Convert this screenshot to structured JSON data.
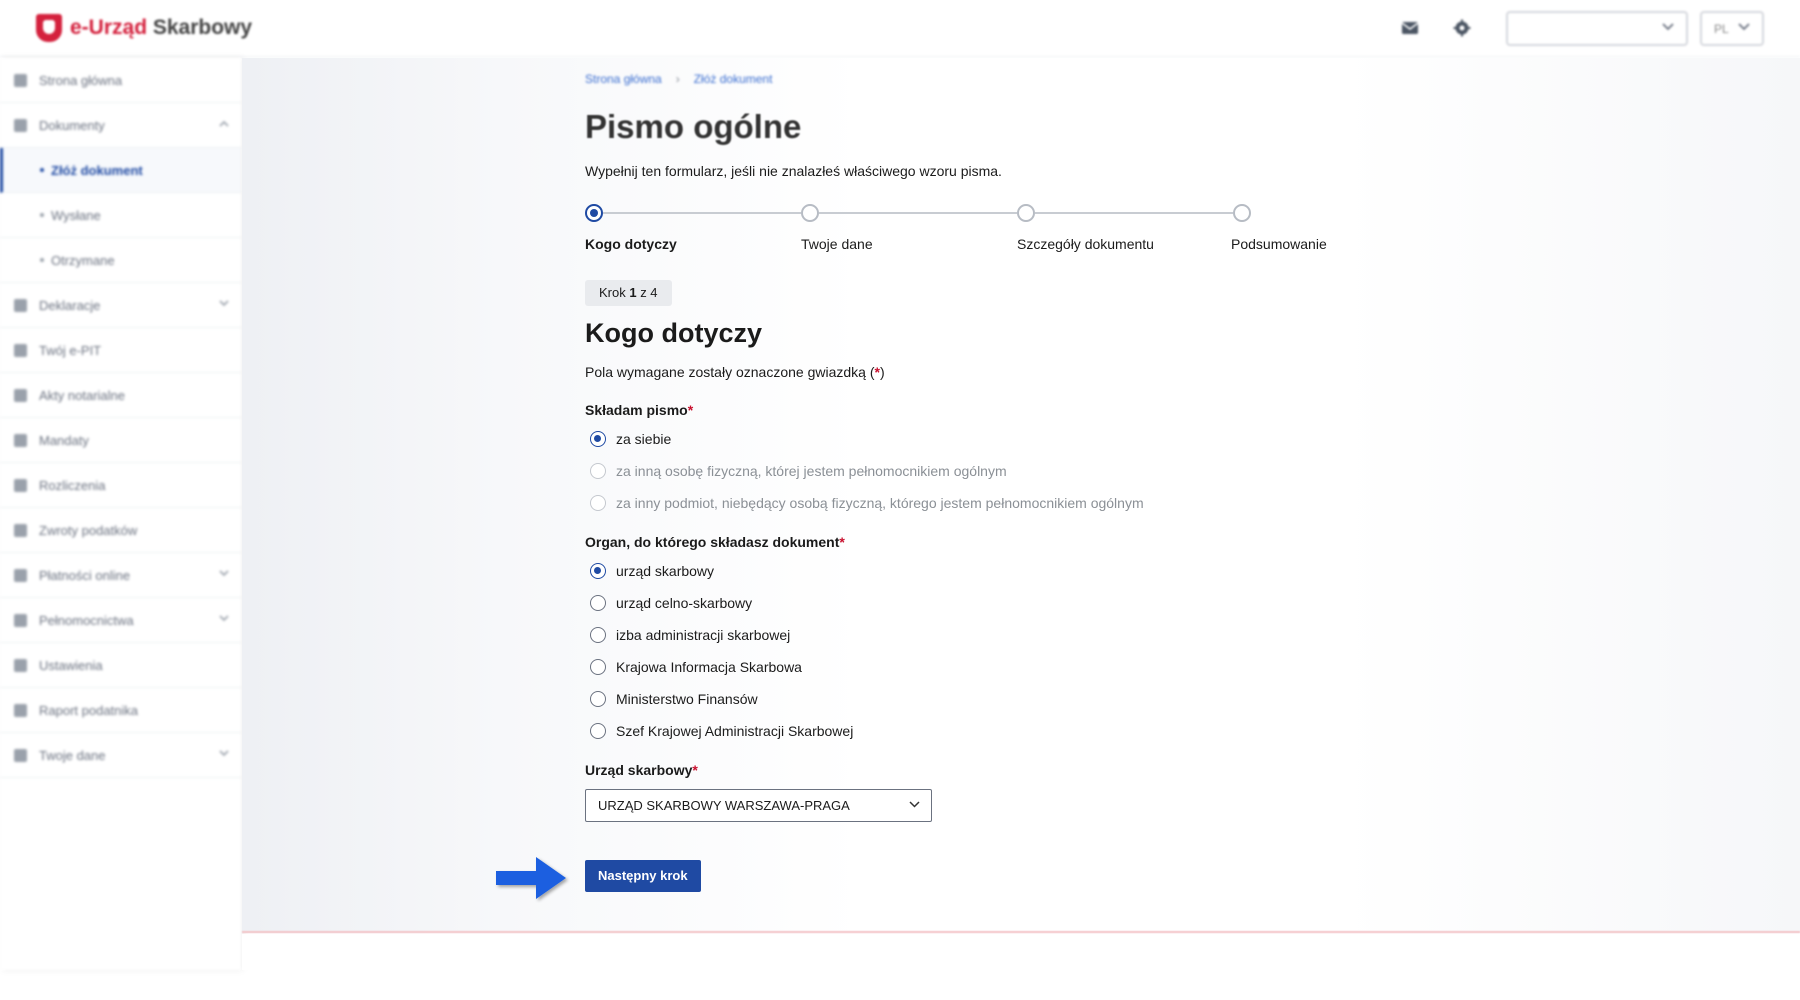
{
  "header": {
    "brand_accent": "e-Urząd",
    "brand_rest": " Skarbowy",
    "lang": "PL",
    "icons": [
      "mail-icon",
      "gear-icon"
    ]
  },
  "sidebar": {
    "items": [
      {
        "label": "Strona główna",
        "icon": "home-icon"
      },
      {
        "label": "Dokumenty",
        "icon": "document-icon",
        "expanded": true
      },
      {
        "label": "Złóż dokument",
        "sub": true,
        "active": true
      },
      {
        "label": "Wysłane",
        "sub": true
      },
      {
        "label": "Otrzymane",
        "sub": true
      },
      {
        "label": "Deklaracje",
        "icon": "document-icon",
        "collapsible": true
      },
      {
        "label": "Twój e-PIT",
        "icon": "document-icon"
      },
      {
        "label": "Akty notarialne",
        "icon": "stamp-icon"
      },
      {
        "label": "Mandaty",
        "icon": "ticket-icon"
      },
      {
        "label": "Rozliczenia",
        "icon": "wallet-icon"
      },
      {
        "label": "Zwroty podatków",
        "icon": "refund-icon",
        "collapsible": false
      },
      {
        "label": "Płatności online",
        "icon": "card-icon",
        "collapsible": true
      },
      {
        "label": "Pełnomocnictwa",
        "icon": "users-icon",
        "collapsible": true
      },
      {
        "label": "Ustawienia",
        "icon": "gear-icon"
      },
      {
        "label": "Raport podatnika",
        "icon": "report-icon"
      },
      {
        "label": "Twoje dane",
        "icon": "user-icon",
        "collapsible": true
      }
    ]
  },
  "breadcrumb": [
    "Strona główna",
    "Złóż dokument"
  ],
  "page": {
    "title": "Pismo ogólne",
    "intro": "Wypełnij ten formularz, jeśli nie znalazłeś właściwego wzoru pisma."
  },
  "stepper": {
    "steps": [
      "Kogo dotyczy",
      "Twoje dane",
      "Szczegóły dokumentu",
      "Podsumowanie"
    ],
    "current": 1,
    "total": 4
  },
  "badge": {
    "prefix": "Krok ",
    "current": "1",
    "suffix": " z 4"
  },
  "section": {
    "title": "Kogo dotyczy",
    "required_note_before": "Pola wymagane zostały oznaczone gwiazdką (",
    "required_star": "*",
    "required_note_after": ")"
  },
  "form": {
    "skladam": {
      "label": "Składam pismo",
      "options": [
        {
          "label": "za siebie",
          "checked": true,
          "disabled": false
        },
        {
          "label": "za inną osobę fizyczną, której jestem pełnomocnikiem ogólnym",
          "checked": false,
          "disabled": true
        },
        {
          "label": "za inny podmiot, niebędący osobą fizyczną, którego jestem pełnomocnikiem ogólnym",
          "checked": false,
          "disabled": true
        }
      ]
    },
    "organ": {
      "label": "Organ, do którego składasz dokument",
      "options": [
        {
          "label": "urząd skarbowy",
          "checked": true
        },
        {
          "label": "urząd celno-skarbowy",
          "checked": false
        },
        {
          "label": "izba administracji skarbowej",
          "checked": false
        },
        {
          "label": "Krajowa Informacja Skarbowa",
          "checked": false
        },
        {
          "label": "Ministerstwo Finansów",
          "checked": false
        },
        {
          "label": "Szef Krajowej Administracji Skarbowej",
          "checked": false
        }
      ]
    },
    "urzad": {
      "label": "Urząd skarbowy",
      "selected": "URZĄD SKARBOWY WARSZAWA-PRAGA"
    },
    "next_button": "Następny krok"
  },
  "colors": {
    "primary": "#1f4aa3",
    "brand_red": "#d4213d",
    "required_red": "#c8102e",
    "annotation_arrow": "#1a5fe0"
  }
}
